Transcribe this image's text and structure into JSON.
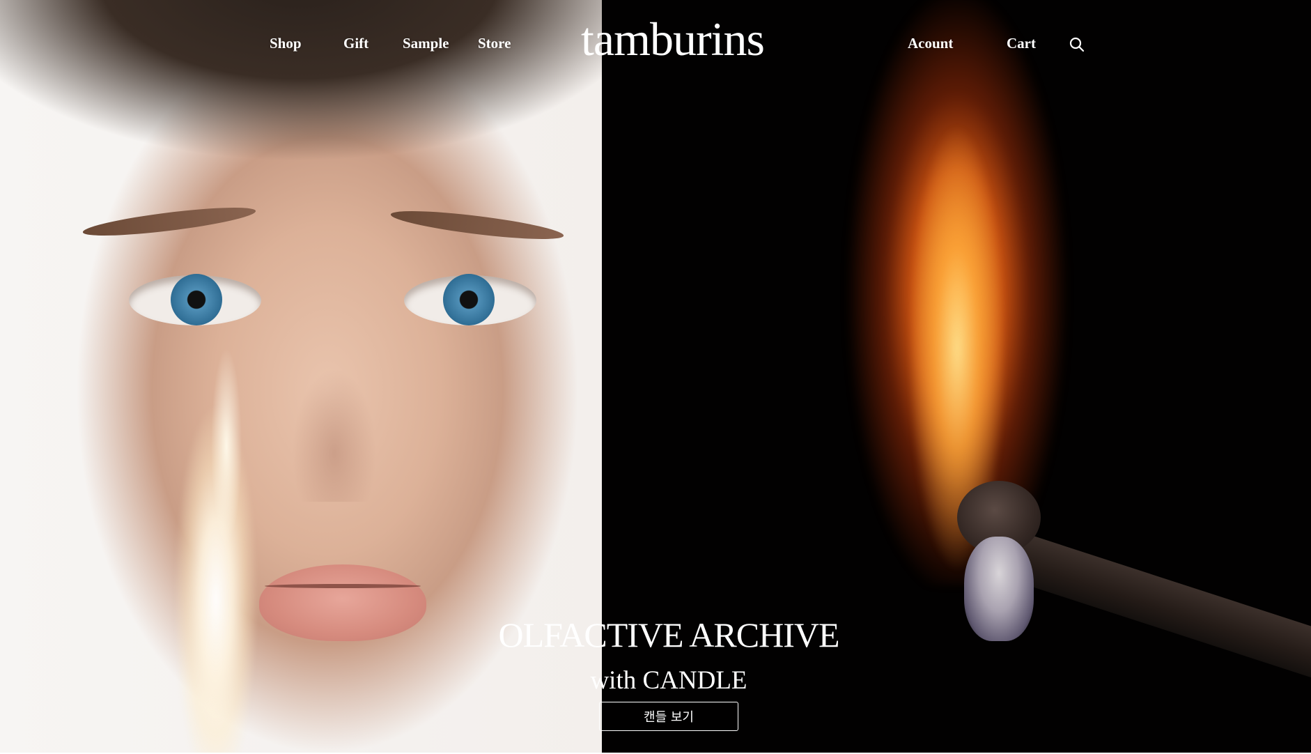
{
  "header": {
    "nav_left": [
      {
        "label": "Shop"
      },
      {
        "label": "Gift"
      },
      {
        "label": "Sample"
      },
      {
        "label": "Store"
      }
    ],
    "logo": "tamburins",
    "nav_right": [
      {
        "label": "Acount"
      },
      {
        "label": "Cart"
      }
    ],
    "search_icon": "search-icon"
  },
  "hero": {
    "title": "OLFACTIVE ARCHIVE",
    "subtitle": "with CANDLE",
    "cta_label": "캔들 보기",
    "colors": {
      "text": "#ffffff",
      "right_panel_background": "#020101",
      "left_panel_background": "#f3efec"
    }
  }
}
